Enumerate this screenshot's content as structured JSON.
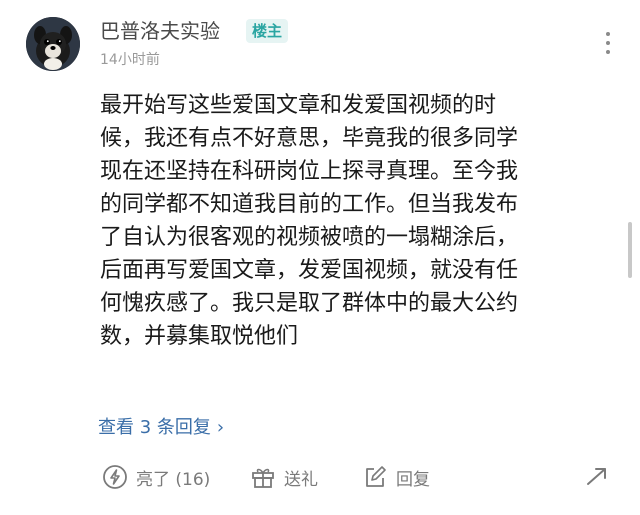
{
  "comment": {
    "username": "巴普洛夫实验",
    "badge": "楼主",
    "time": "14小时前",
    "lines": [
      "最开始写这些爱国文章和发爱国视频的时",
      "候，我还有点不好意思，毕竟我的很多同学",
      "现在还坚持在科研岗位上探寻真理。至今我",
      "的同学都不知道我目前的工作。但当我发布",
      "了自认为很客观的视频被喷的一塌糊涂后，",
      "后面再写爱国文章，发爱国视频，就没有任",
      "何愧疚感了。我只是取了群体中的最大公约",
      "数，并募集取悦他们"
    ],
    "replies_link": "查看 3 条回复",
    "replies_chevron": "›"
  },
  "actions": {
    "like_label": "亮了 (16)",
    "gift_label": "送礼",
    "reply_label": "回复"
  },
  "colors": {
    "badge_text": "#2aa5a2",
    "badge_bg": "#e6f4f3",
    "link": "#3a6ea8",
    "muted": "#9a9a9a"
  },
  "icons": {
    "more": "more-vertical-icon",
    "like": "lightning-icon",
    "gift": "gift-icon",
    "reply": "edit-icon",
    "share": "share-arrow-icon"
  }
}
